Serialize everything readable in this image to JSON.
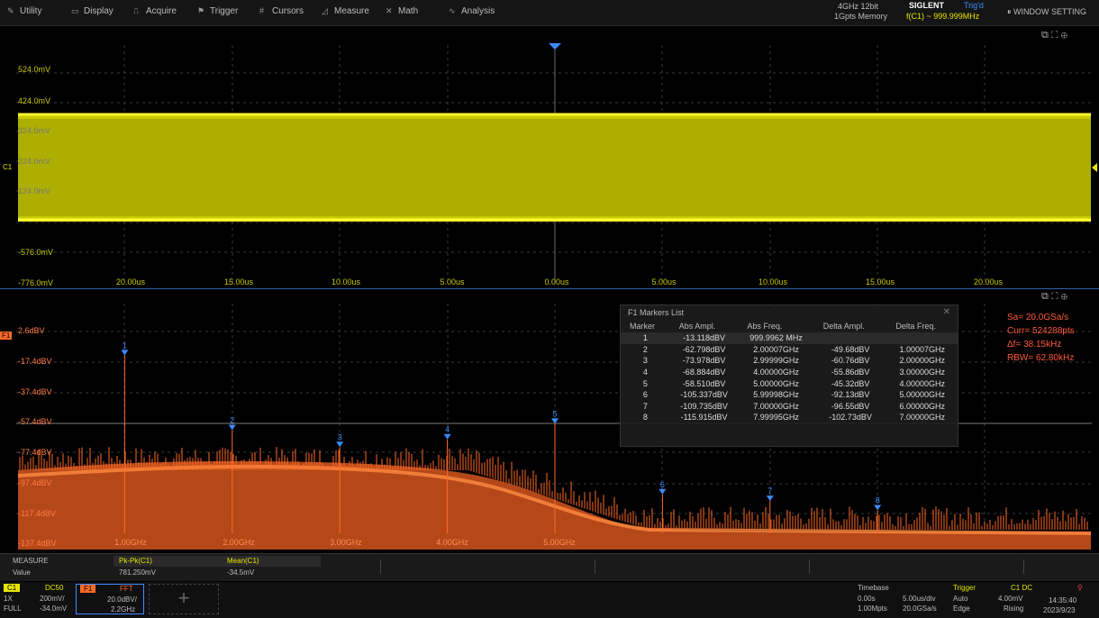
{
  "menu": [
    {
      "label": "Utility",
      "icon": "wrench-icon"
    },
    {
      "label": "Display",
      "icon": "display-icon"
    },
    {
      "label": "Acquire",
      "icon": "acquire-icon"
    },
    {
      "label": "Trigger",
      "icon": "trigger-icon"
    },
    {
      "label": "Cursors",
      "icon": "cursor-icon"
    },
    {
      "label": "Measure",
      "icon": "measure-icon"
    },
    {
      "label": "Math",
      "icon": "math-icon"
    },
    {
      "label": "Analysis",
      "icon": "analysis-icon"
    }
  ],
  "header_info": {
    "spec_line1": "4GHz 12bit",
    "spec_line2": "1Gpts Memory",
    "brand": "SIGLENT",
    "status": "Trig'd",
    "freq": "f(C1) ~ 999.999MHz",
    "window_setting": "WINDOW SETTING"
  },
  "time_pane": {
    "y_labels": [
      "524.0mV",
      "424.0mV",
      "324.0mV",
      "224.0mV",
      "124.0mV",
      "-576.0mV",
      "-776.0mV"
    ],
    "x_labels": [
      "20.00us",
      "15.00us",
      "10.00us",
      "5.00us",
      "0.00us",
      "5.00us",
      "10.00us",
      "15.00us",
      "20.00us"
    ],
    "channel_marker": "C1",
    "trace_color": "#e6e600"
  },
  "fft_pane": {
    "badge": "F1",
    "y_labels": [
      "2.6dBV",
      "-17.4dBV",
      "-37.4dBV",
      "-57.4dBV",
      "-77.4dBV",
      "-97.4dBV",
      "-117.4dBV",
      "-137.4dBV"
    ],
    "x_labels": [
      "1.00GHz",
      "2.00GHz",
      "3.00GHz",
      "4.00GHz",
      "5.00GHz"
    ],
    "trace_color": "#ff6a28",
    "marker_color": "#3d8bff",
    "params": [
      "Sa= 20.0GSa/s",
      "Curr= 524288pts",
      "Δf= 38.15kHz",
      "RBW= 62.80kHz"
    ]
  },
  "marker_list": {
    "title": "F1 Markers List",
    "headers": [
      "Marker",
      "Abs Ampl.",
      "Abs Freq.",
      "Delta Ampl.",
      "Delta Freq."
    ],
    "rows": [
      {
        "marker": "1",
        "abs_ampl": "-13.118dBV",
        "abs_freq": "999.9962 MHz",
        "delta_ampl": "",
        "delta_freq": ""
      },
      {
        "marker": "2",
        "abs_ampl": "-62.798dBV",
        "abs_freq": "2.00007GHz",
        "delta_ampl": "-49.68dBV",
        "delta_freq": "1.00007GHz"
      },
      {
        "marker": "3",
        "abs_ampl": "-73.978dBV",
        "abs_freq": "2.99999GHz",
        "delta_ampl": "-60.76dBV",
        "delta_freq": "2.00000GHz"
      },
      {
        "marker": "4",
        "abs_ampl": "-68.884dBV",
        "abs_freq": "4.00000GHz",
        "delta_ampl": "-55.86dBV",
        "delta_freq": "3.00000GHz"
      },
      {
        "marker": "5",
        "abs_ampl": "-58.510dBV",
        "abs_freq": "5.00000GHz",
        "delta_ampl": "-45.32dBV",
        "delta_freq": "4.00000GHz"
      },
      {
        "marker": "6",
        "abs_ampl": "-105.337dBV",
        "abs_freq": "5.99998GHz",
        "delta_ampl": "-92.13dBV",
        "delta_freq": "5.00000GHz"
      },
      {
        "marker": "7",
        "abs_ampl": "-109.735dBV",
        "abs_freq": "7.00000GHz",
        "delta_ampl": "-96.55dBV",
        "delta_freq": "6.00000GHz"
      },
      {
        "marker": "8",
        "abs_ampl": "-115.915dBV",
        "abs_freq": "7.99995GHz",
        "delta_ampl": "-102.73dBV",
        "delta_freq": "7.00000GHz"
      }
    ],
    "close_icon": "close-icon"
  },
  "markers": [
    {
      "label": "1",
      "freq_ghz": 1.0,
      "dbv": -13.118
    },
    {
      "label": "2",
      "freq_ghz": 2.0,
      "dbv": -62.798
    },
    {
      "label": "3",
      "freq_ghz": 3.0,
      "dbv": -73.978
    },
    {
      "label": "4",
      "freq_ghz": 4.0,
      "dbv": -68.884
    },
    {
      "label": "5",
      "freq_ghz": 5.0,
      "dbv": -58.51
    },
    {
      "label": "6",
      "freq_ghz": 6.0,
      "dbv": -105.337
    },
    {
      "label": "7",
      "freq_ghz": 7.0,
      "dbv": -109.735
    },
    {
      "label": "8",
      "freq_ghz": 8.0,
      "dbv": -115.915
    }
  ],
  "measure": {
    "title": "MEASURE",
    "row_label": "Value",
    "items": [
      {
        "name": "Pk-Pk(C1)",
        "value": "781.250mV"
      },
      {
        "name": "Mean(C1)",
        "value": "-34.5mV"
      }
    ]
  },
  "bottom": {
    "c1": {
      "label": "C1",
      "coupling": "DC50",
      "line1a": "1X",
      "line1b": "200mV/",
      "line2a": "FULL",
      "line2b": "-34.0mV"
    },
    "f1": {
      "label": "F1",
      "mode": "FFT",
      "line1": "20.0dBV/",
      "line2": "2.2GHz"
    },
    "timebase": {
      "title": "Timebase",
      "l1a": "0.00s",
      "l1b": "5.00us/div",
      "l2a": "1.00Mpts",
      "l2b": "20.0GSa/s"
    },
    "trigger": {
      "title": "Trigger",
      "l0": "C1 DC",
      "l1a": "Auto",
      "l1b": "4.00mV",
      "l2a": "Edge",
      "l2b": "Rising"
    },
    "clock": {
      "time": "14:35:40",
      "date": "2023/9/23"
    }
  }
}
